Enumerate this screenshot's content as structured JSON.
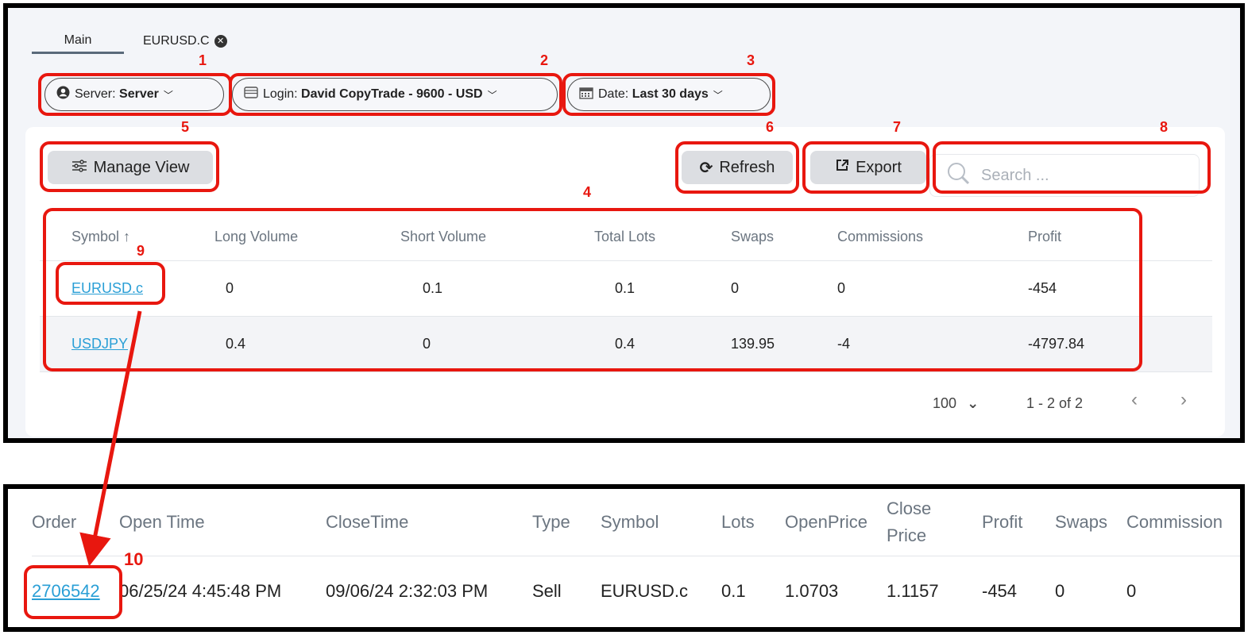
{
  "tabs": [
    {
      "label": "Main"
    },
    {
      "label": "EURUSD.C"
    }
  ],
  "filters": {
    "server": {
      "prefix": "Server:",
      "value": "Server"
    },
    "login": {
      "prefix": "Login:",
      "value": "David CopyTrade - 9600 - USD"
    },
    "date": {
      "prefix": "Date:",
      "value": "Last 30 days"
    }
  },
  "toolbar": {
    "manage_view": "Manage View",
    "refresh": "Refresh",
    "export": "Export",
    "search_placeholder": "Search ..."
  },
  "summary_table": {
    "headers": [
      "Symbol",
      "Long Volume",
      "Short Volume",
      "Total Lots",
      "Swaps",
      "Commissions",
      "Profit"
    ],
    "sort_indicator": "↑",
    "rows": [
      {
        "symbol": "EURUSD.c",
        "long": "0",
        "short": "0.1",
        "lots": "0.1",
        "swaps": "0",
        "commissions": "0",
        "profit": "-454"
      },
      {
        "symbol": "USDJPY",
        "long": "0.4",
        "short": "0",
        "lots": "0.4",
        "swaps": "139.95",
        "commissions": "-4",
        "profit": "-4797.84"
      }
    ]
  },
  "pagination": {
    "page_size": "100",
    "range": "1 - 2 of 2",
    "prev": "‹",
    "next": "›"
  },
  "orders_table": {
    "headers": {
      "order": "Order",
      "open_time": "Open Time",
      "close_time": "CloseTime",
      "type": "Type",
      "symbol": "Symbol",
      "lots": "Lots",
      "open_price": "OpenPrice",
      "close_price_1": "Close",
      "close_price_2": "Price",
      "profit": "Profit",
      "swaps": "Swaps",
      "commission": "Commission"
    },
    "rows": [
      {
        "order": "2706542",
        "open_time": "06/25/24 4:45:48 PM",
        "close_time": "09/06/24 2:32:03 PM",
        "type": "Sell",
        "symbol": "EURUSD.c",
        "lots": "0.1",
        "open_price": "1.0703",
        "close_price": "1.1157",
        "profit": "-454",
        "swaps": "0",
        "commission": "0"
      }
    ]
  },
  "annotations": [
    "1",
    "2",
    "3",
    "4",
    "5",
    "6",
    "7",
    "8",
    "9",
    "10"
  ],
  "colors": {
    "annotation": "#e8170f",
    "link": "#2a9fd6",
    "button": "#dcdee2"
  }
}
